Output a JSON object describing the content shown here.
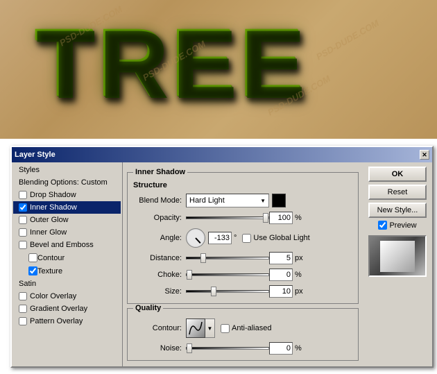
{
  "canvas": {
    "watermarks": [
      "PSD-DUDE.COM",
      "PSD-DUDE.COM",
      "PSD-DUDE.COM",
      "PSD-DUDE.COM"
    ],
    "tree_text": "TREE"
  },
  "dialog": {
    "title": "Layer Style",
    "close_label": "✕",
    "left_panel": {
      "items": [
        {
          "id": "styles",
          "label": "Styles",
          "type": "plain"
        },
        {
          "id": "blending",
          "label": "Blending Options: Custom",
          "type": "plain"
        },
        {
          "id": "drop-shadow",
          "label": "Drop Shadow",
          "type": "checkbox",
          "checked": false
        },
        {
          "id": "inner-shadow",
          "label": "Inner Shadow",
          "type": "checkbox",
          "checked": true,
          "selected": true
        },
        {
          "id": "outer-glow",
          "label": "Outer Glow",
          "type": "checkbox",
          "checked": false
        },
        {
          "id": "inner-glow",
          "label": "Inner Glow",
          "type": "checkbox",
          "checked": false
        },
        {
          "id": "bevel-emboss",
          "label": "Bevel and Emboss",
          "type": "checkbox",
          "checked": false
        },
        {
          "id": "contour",
          "label": "Contour",
          "type": "sub-checkbox",
          "checked": false
        },
        {
          "id": "texture",
          "label": "Texture",
          "type": "sub-checkbox",
          "checked": true
        },
        {
          "id": "satin",
          "label": "Satin",
          "type": "plain"
        },
        {
          "id": "color-overlay",
          "label": "Color Overlay",
          "type": "checkbox",
          "checked": false
        },
        {
          "id": "gradient-overlay",
          "label": "Gradient Overlay",
          "type": "checkbox",
          "checked": false
        },
        {
          "id": "pattern-overlay",
          "label": "Pattern Overlay",
          "type": "checkbox",
          "checked": false
        }
      ]
    },
    "inner_shadow": {
      "section_title": "Inner Shadow",
      "structure_label": "Structure",
      "blend_mode_label": "Blend Mode:",
      "blend_mode_value": "Hard Light",
      "opacity_label": "Opacity:",
      "opacity_value": "100",
      "opacity_unit": "%",
      "angle_label": "Angle:",
      "angle_value": "-133",
      "angle_unit": "°",
      "use_global_light_label": "Use Global Light",
      "distance_label": "Distance:",
      "distance_value": "5",
      "distance_unit": "px",
      "choke_label": "Choke:",
      "choke_value": "0",
      "choke_unit": "%",
      "size_label": "Size:",
      "size_value": "10",
      "size_unit": "px"
    },
    "quality": {
      "section_title": "Quality",
      "contour_label": "Contour:",
      "anti_aliased_label": "Anti-aliased",
      "noise_label": "Noise:",
      "noise_value": "0",
      "noise_unit": "%"
    },
    "buttons": {
      "ok": "OK",
      "reset": "Reset",
      "new_style": "New Style...",
      "preview_label": "Preview"
    }
  }
}
